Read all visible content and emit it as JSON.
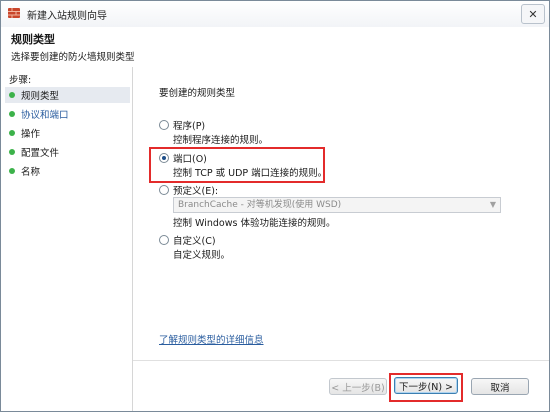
{
  "window": {
    "title": "新建入站规则向导",
    "close_symbol": "✕"
  },
  "header": {
    "title": "规则类型",
    "subtitle": "选择要创建的防火墙规则类型"
  },
  "sidebar": {
    "steps_label": "步骤:",
    "items": [
      {
        "label": "规则类型",
        "active": true,
        "bullet_color": "#3cb24a"
      },
      {
        "label": "协议和端口",
        "active": false,
        "bullet_color": "#3cb24a"
      },
      {
        "label": "操作",
        "active": false,
        "bullet_color": "#3cb24a"
      },
      {
        "label": "配置文件",
        "active": false,
        "bullet_color": "#3cb24a"
      },
      {
        "label": "名称",
        "active": false,
        "bullet_color": "#3cb24a"
      }
    ]
  },
  "main": {
    "question": "要创建的规则类型",
    "options": [
      {
        "title": "程序(P)",
        "desc": "控制程序连接的规则。",
        "checked": false
      },
      {
        "title": "端口(O)",
        "desc": "控制 TCP 或 UDP 端口连接的规则。",
        "checked": true
      },
      {
        "title": "预定义(E):",
        "desc": "控制 Windows 体验功能连接的规则。",
        "checked": false
      },
      {
        "title": "自定义(C)",
        "desc": "自定义规则。",
        "checked": false
      }
    ],
    "predefined_select": {
      "value": "BranchCache - 对等机发现(使用 WSD)"
    },
    "help_link": "了解规则类型的详细信息"
  },
  "buttons": {
    "back": "< 上一步(B)",
    "next": "下一步(N) >",
    "cancel": "取消"
  },
  "colors": {
    "highlight": "#e32b2b",
    "link": "#2a5d9f"
  }
}
